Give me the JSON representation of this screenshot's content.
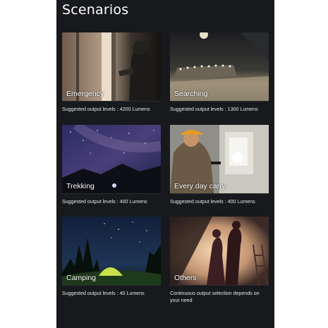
{
  "title": "Scenarios",
  "scenarios": [
    {
      "label": "Emergency",
      "caption": "Suggested output levels : 4200 Lumens"
    },
    {
      "label": "Searching",
      "caption": "Suggested output levels : 1300 Lumens"
    },
    {
      "label": "Trekking",
      "caption": "Suggested output levels : 400 Lumens"
    },
    {
      "label": "Every day carry",
      "caption": "Suggested output levels : 400 Lumens"
    },
    {
      "label": "Camping",
      "caption": "Suggested output levels : 40 Lumens"
    },
    {
      "label": "Others",
      "caption": "Continuous output selection depends on your need"
    }
  ]
}
